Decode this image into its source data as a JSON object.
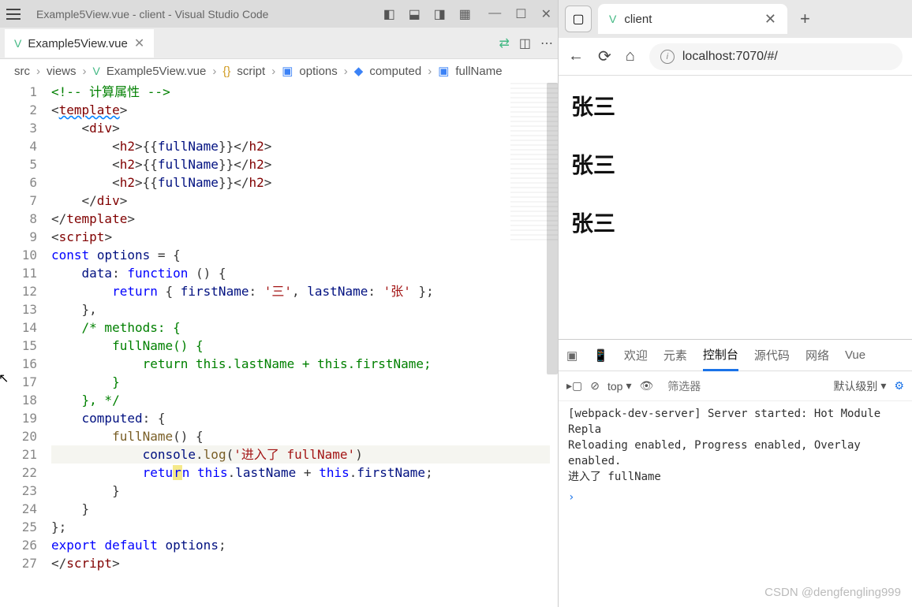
{
  "vscode": {
    "title": "Example5View.vue - client - Visual Studio Code",
    "tab": {
      "name": "Example5View.vue"
    },
    "breadcrumb": [
      "src",
      "views",
      "Example5View.vue",
      "script",
      "options",
      "computed",
      "fullName"
    ],
    "code_lines": [
      {
        "n": 1,
        "segs": [
          {
            "t": "<!-- 计算属性 -->",
            "c": "c-comment"
          }
        ]
      },
      {
        "n": 2,
        "segs": [
          {
            "t": "<",
            "c": "c-punct"
          },
          {
            "t": "template",
            "c": "c-tag squiggle"
          },
          {
            "t": ">",
            "c": "c-punct"
          }
        ]
      },
      {
        "n": 3,
        "segs": [
          {
            "t": "    ",
            "c": ""
          },
          {
            "t": "<",
            "c": "c-punct"
          },
          {
            "t": "div",
            "c": "c-tag"
          },
          {
            "t": ">",
            "c": "c-punct"
          }
        ]
      },
      {
        "n": 4,
        "segs": [
          {
            "t": "        ",
            "c": ""
          },
          {
            "t": "<",
            "c": "c-punct"
          },
          {
            "t": "h2",
            "c": "c-tag"
          },
          {
            "t": ">",
            "c": "c-punct"
          },
          {
            "t": "{{",
            "c": "c-punct"
          },
          {
            "t": "fullName",
            "c": "c-expr"
          },
          {
            "t": "}}",
            "c": "c-punct"
          },
          {
            "t": "</",
            "c": "c-punct"
          },
          {
            "t": "h2",
            "c": "c-tag"
          },
          {
            "t": ">",
            "c": "c-punct"
          }
        ]
      },
      {
        "n": 5,
        "segs": [
          {
            "t": "        ",
            "c": ""
          },
          {
            "t": "<",
            "c": "c-punct"
          },
          {
            "t": "h2",
            "c": "c-tag"
          },
          {
            "t": ">",
            "c": "c-punct"
          },
          {
            "t": "{{",
            "c": "c-punct"
          },
          {
            "t": "fullName",
            "c": "c-expr"
          },
          {
            "t": "}}",
            "c": "c-punct"
          },
          {
            "t": "</",
            "c": "c-punct"
          },
          {
            "t": "h2",
            "c": "c-tag"
          },
          {
            "t": ">",
            "c": "c-punct"
          }
        ]
      },
      {
        "n": 6,
        "segs": [
          {
            "t": "        ",
            "c": ""
          },
          {
            "t": "<",
            "c": "c-punct"
          },
          {
            "t": "h2",
            "c": "c-tag"
          },
          {
            "t": ">",
            "c": "c-punct"
          },
          {
            "t": "{{",
            "c": "c-punct"
          },
          {
            "t": "fullName",
            "c": "c-expr"
          },
          {
            "t": "}}",
            "c": "c-punct"
          },
          {
            "t": "</",
            "c": "c-punct"
          },
          {
            "t": "h2",
            "c": "c-tag"
          },
          {
            "t": ">",
            "c": "c-punct"
          }
        ]
      },
      {
        "n": 7,
        "segs": [
          {
            "t": "    ",
            "c": ""
          },
          {
            "t": "</",
            "c": "c-punct"
          },
          {
            "t": "div",
            "c": "c-tag"
          },
          {
            "t": ">",
            "c": "c-punct"
          }
        ]
      },
      {
        "n": 8,
        "segs": [
          {
            "t": "</",
            "c": "c-punct"
          },
          {
            "t": "template",
            "c": "c-tag"
          },
          {
            "t": ">",
            "c": "c-punct"
          }
        ]
      },
      {
        "n": 9,
        "segs": [
          {
            "t": "<",
            "c": "c-punct"
          },
          {
            "t": "script",
            "c": "c-tag"
          },
          {
            "t": ">",
            "c": "c-punct"
          }
        ]
      },
      {
        "n": 10,
        "segs": [
          {
            "t": "const",
            "c": "c-keyword"
          },
          {
            "t": " ",
            "c": ""
          },
          {
            "t": "options",
            "c": "c-var"
          },
          {
            "t": " = {",
            "c": "c-punct"
          }
        ]
      },
      {
        "n": 11,
        "segs": [
          {
            "t": "    ",
            "c": ""
          },
          {
            "t": "data",
            "c": "c-var"
          },
          {
            "t": ": ",
            "c": "c-punct"
          },
          {
            "t": "function",
            "c": "c-keyword"
          },
          {
            "t": " () {",
            "c": "c-punct"
          }
        ]
      },
      {
        "n": 12,
        "segs": [
          {
            "t": "        ",
            "c": ""
          },
          {
            "t": "return",
            "c": "c-keyword"
          },
          {
            "t": " { ",
            "c": "c-punct"
          },
          {
            "t": "firstName",
            "c": "c-var"
          },
          {
            "t": ": ",
            "c": "c-punct"
          },
          {
            "t": "'三'",
            "c": "c-string"
          },
          {
            "t": ", ",
            "c": "c-punct"
          },
          {
            "t": "lastName",
            "c": "c-var"
          },
          {
            "t": ": ",
            "c": "c-punct"
          },
          {
            "t": "'张'",
            "c": "c-string"
          },
          {
            "t": " };",
            "c": "c-punct"
          }
        ]
      },
      {
        "n": 13,
        "segs": [
          {
            "t": "    },",
            "c": "c-punct"
          }
        ]
      },
      {
        "n": 14,
        "segs": [
          {
            "t": "    ",
            "c": ""
          },
          {
            "t": "/* methods: {",
            "c": "c-comment"
          }
        ]
      },
      {
        "n": 15,
        "segs": [
          {
            "t": "        fullName() {",
            "c": "c-comment"
          }
        ]
      },
      {
        "n": 16,
        "segs": [
          {
            "t": "            return this.lastName + this.firstName;",
            "c": "c-comment"
          }
        ]
      },
      {
        "n": 17,
        "segs": [
          {
            "t": "        }",
            "c": "c-comment"
          }
        ]
      },
      {
        "n": 18,
        "segs": [
          {
            "t": "    }, */",
            "c": "c-comment"
          }
        ]
      },
      {
        "n": 19,
        "segs": [
          {
            "t": "    ",
            "c": ""
          },
          {
            "t": "computed",
            "c": "c-var"
          },
          {
            "t": ": {",
            "c": "c-punct"
          }
        ]
      },
      {
        "n": 20,
        "segs": [
          {
            "t": "        ",
            "c": ""
          },
          {
            "t": "fullName",
            "c": "c-func"
          },
          {
            "t": "() {",
            "c": "c-punct"
          }
        ]
      },
      {
        "n": 21,
        "hl": true,
        "segs": [
          {
            "t": "            ",
            "c": ""
          },
          {
            "t": "console",
            "c": "c-var"
          },
          {
            "t": ".",
            "c": "c-punct"
          },
          {
            "t": "log",
            "c": "c-func"
          },
          {
            "t": "(",
            "c": "c-punct"
          },
          {
            "t": "'进入了 fullName'",
            "c": "c-string"
          },
          {
            "t": ")",
            "c": "c-punct"
          }
        ]
      },
      {
        "n": 22,
        "segs": [
          {
            "t": "            ",
            "c": ""
          },
          {
            "t": "retu",
            "c": "c-keyword"
          },
          {
            "t": "r",
            "c": "c-keyword caret-hl"
          },
          {
            "t": "n",
            "c": "c-keyword"
          },
          {
            "t": " ",
            "c": ""
          },
          {
            "t": "this",
            "c": "c-this"
          },
          {
            "t": ".",
            "c": "c-punct"
          },
          {
            "t": "lastName",
            "c": "c-prop"
          },
          {
            "t": " + ",
            "c": "c-punct"
          },
          {
            "t": "this",
            "c": "c-this"
          },
          {
            "t": ".",
            "c": "c-punct"
          },
          {
            "t": "firstName",
            "c": "c-prop"
          },
          {
            "t": ";",
            "c": "c-punct"
          }
        ]
      },
      {
        "n": 23,
        "segs": [
          {
            "t": "        }",
            "c": "c-punct"
          }
        ]
      },
      {
        "n": 24,
        "segs": [
          {
            "t": "    }",
            "c": "c-punct"
          }
        ]
      },
      {
        "n": 25,
        "segs": [
          {
            "t": "};",
            "c": "c-punct"
          }
        ]
      },
      {
        "n": 26,
        "segs": [
          {
            "t": "export",
            "c": "c-keyword"
          },
          {
            "t": " ",
            "c": ""
          },
          {
            "t": "default",
            "c": "c-keyword"
          },
          {
            "t": " ",
            "c": ""
          },
          {
            "t": "options",
            "c": "c-var"
          },
          {
            "t": ";",
            "c": "c-punct"
          }
        ]
      },
      {
        "n": 27,
        "segs": [
          {
            "t": "</",
            "c": "c-punct"
          },
          {
            "t": "script",
            "c": "c-tag"
          },
          {
            "t": ">",
            "c": "c-punct"
          }
        ]
      }
    ]
  },
  "browser": {
    "tab_name": "client",
    "url": "localhost:7070/#/",
    "page_h2": [
      "张三",
      "张三",
      "张三"
    ],
    "devtools": {
      "tabs": [
        "欢迎",
        "元素",
        "控制台",
        "源代码",
        "网络",
        "Vue"
      ],
      "active_tab": 2,
      "context": "top",
      "filter_placeholder": "筛选器",
      "level": "默认级别",
      "console_lines": [
        "[webpack-dev-server] Server started: Hot Module Repla",
        "Reloading enabled, Progress enabled, Overlay enabled.",
        "进入了 fullName"
      ]
    }
  },
  "watermark": "CSDN @dengfengling999"
}
